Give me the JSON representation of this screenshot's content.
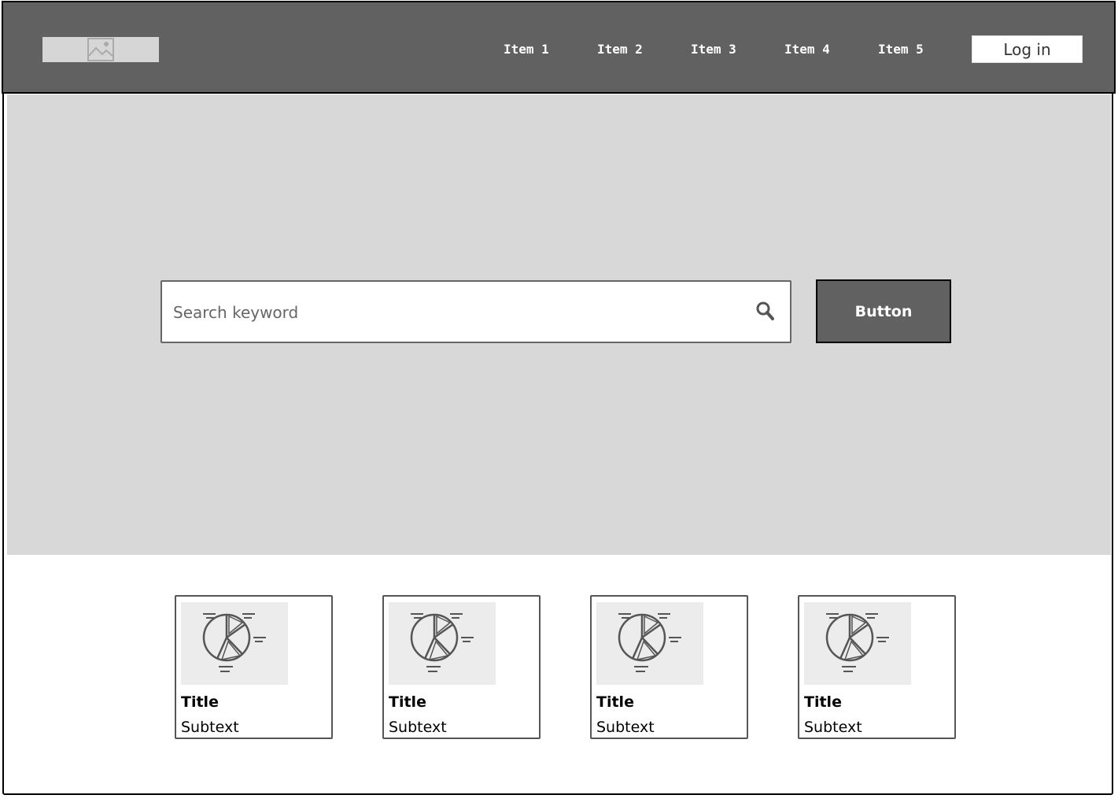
{
  "nav": {
    "logo_icon": "image-placeholder-icon",
    "items": [
      "Item 1",
      "Item 2",
      "Item 3",
      "Item 4",
      "Item 5"
    ],
    "login_label": "Log in"
  },
  "hero": {
    "search": {
      "placeholder": "Search keyword",
      "icon": "search-icon"
    },
    "button_label": "Button"
  },
  "cards": [
    {
      "title": "Title",
      "subtext": "Subtext",
      "thumb_icon": "pie-chart-icon"
    },
    {
      "title": "Title",
      "subtext": "Subtext",
      "thumb_icon": "pie-chart-icon"
    },
    {
      "title": "Title",
      "subtext": "Subtext",
      "thumb_icon": "pie-chart-icon"
    },
    {
      "title": "Title",
      "subtext": "Subtext",
      "thumb_icon": "pie-chart-icon"
    }
  ],
  "colors": {
    "navbar_bg": "#616161",
    "hero_bg": "#d8d8d8",
    "button_bg": "#616161",
    "thumb_bg": "#ececec"
  }
}
